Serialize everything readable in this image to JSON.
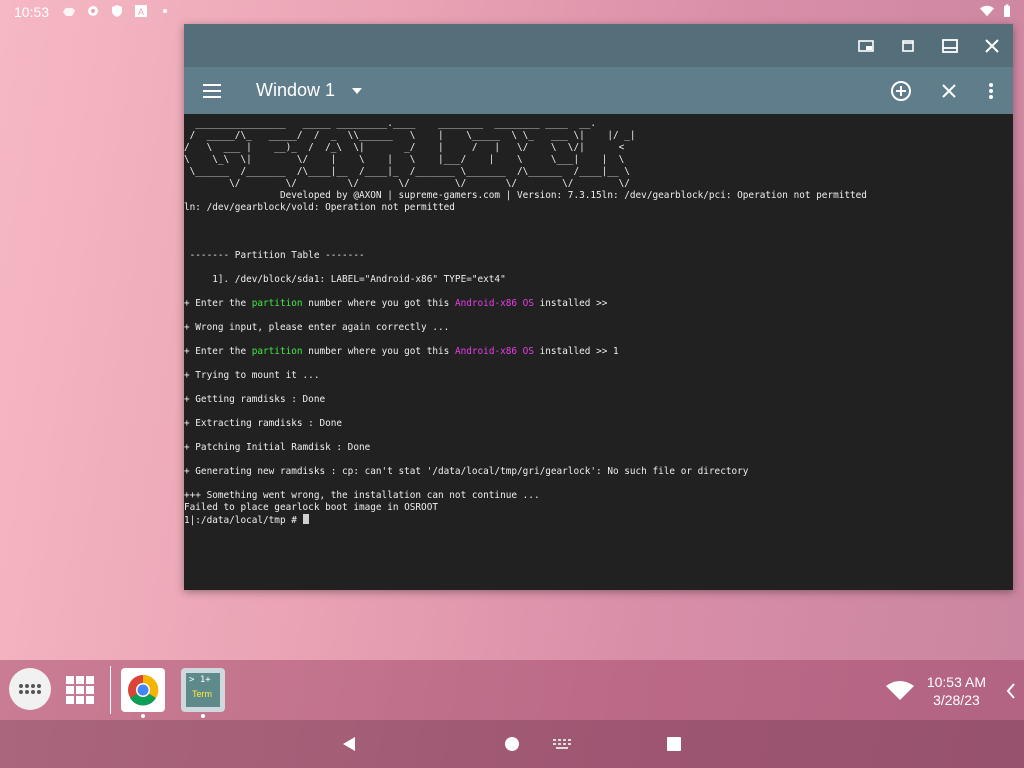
{
  "status_bar": {
    "time": "10:53",
    "icons": [
      "weather-icon",
      "settings-gear-icon",
      "shield-icon",
      "font-icon",
      "dot-icon"
    ],
    "right_icons": [
      "wifi-icon",
      "battery-icon"
    ]
  },
  "window": {
    "title": "Window 1",
    "titlebar_buttons": [
      "pip-icon",
      "restore-icon",
      "maximize-icon",
      "close-icon"
    ],
    "app_buttons": [
      "menu-icon",
      "dropdown-icon",
      "add-window-icon",
      "close-window-icon",
      "overflow-icon"
    ]
  },
  "terminal": {
    "banner": [
      "  ________________   _____ _________.____    ________  ________ ____  __.",
      " /  _____/\\_   _____/  /  _  \\\\______   \\    |    \\_____  \\ \\_   ___ \\|    |/ _|",
      "/   \\  ___ |    __)_  /  /_\\  \\|       _/    |     /   |   \\/    \\  \\/|      <",
      "\\    \\_\\  \\|        \\/    |    \\    |   \\    |___/    |    \\     \\___|    |  \\",
      " \\______  /_______  /\\____|__  /____|_  /_______ \\_______  /\\______  /____|__ \\",
      "        \\/        \\/         \\/       \\/        \\/       \\/        \\/        \\/"
    ],
    "developed_line": "                 Developed by @AXON | supreme-gamers.com | Version: 7.3.15ln: /dev/gearblock/pci: Operation not permitted",
    "ln_line": "ln: /dev/gearblock/vold: Operation not permitted",
    "partition_header": " ------- Partition Table -------",
    "partition_entry": "     1]. /dev/block/sda1: LABEL=\"Android-x86\" TYPE=\"ext4\"",
    "enter_prefix": "+ Enter the ",
    "partition_word": "partition",
    "enter_middle": " number where you got this ",
    "os_word": "Android-x86 OS",
    "enter_suffix": " installed >>",
    "enter_suffix_2": " installed >> 1",
    "wrong_input": "+ Wrong input, please enter again correctly ...",
    "trying_mount": "+ Trying to mount it ...",
    "getting_ramdisks": "+ Getting ramdisks : Done",
    "extracting_ramdisks": "+ Extracting ramdisks : Done",
    "patching_ramdisk": "+ Patching Initial Ramdisk : Done",
    "generating_ramdisks": "+ Generating new ramdisks : cp: can't stat '/data/local/tmp/gri/gearlock': No such file or directory",
    "wrong_line": "+++ Something went wrong, the installation can not continue ...",
    "failed_line": "Failed to place gearlock boot image in OSROOT",
    "prompt": "1|:/data/local/tmp # "
  },
  "taskbar": {
    "apps": [
      "app-drawer-icon",
      "all-apps-grid-icon",
      "chrome-icon",
      "terminal-app-icon"
    ],
    "terminal_icon_text": "> 1+",
    "terminal_icon_label": "Term",
    "clock_time": "10:53 AM",
    "clock_date": "3/28/23"
  },
  "navigation": {
    "buttons": [
      "back-icon",
      "home-icon",
      "keyboard-icon",
      "recents-icon"
    ]
  },
  "colors": {
    "titlebar": "#546e7a",
    "appbar": "#607d8b",
    "terminal_bg": "#212121",
    "terminal_text": "#eeeeee",
    "highlight_green": "#43e843",
    "highlight_magenta": "#e83ee8"
  }
}
